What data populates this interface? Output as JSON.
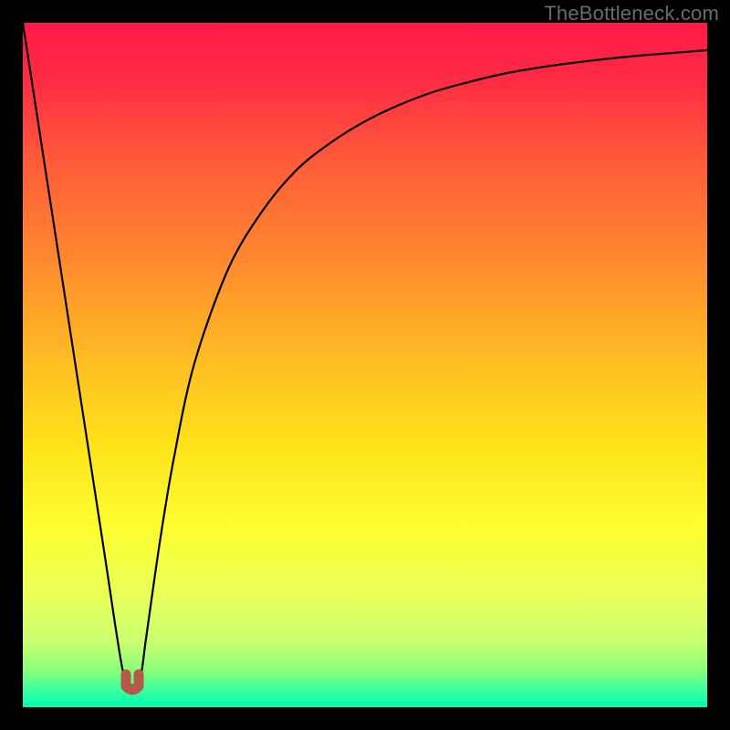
{
  "credit": "TheBottleneck.com",
  "chart_data": {
    "type": "line",
    "title": "",
    "xlabel": "",
    "ylabel": "",
    "xlim": [
      0,
      100
    ],
    "ylim": [
      0,
      100
    ],
    "series": [
      {
        "name": "bottleneck-curve",
        "x": [
          0,
          2,
          4,
          6,
          8,
          10,
          12,
          13.5,
          14.8,
          16,
          17.2,
          18,
          20,
          22,
          25,
          30,
          35,
          40,
          45,
          50,
          55,
          60,
          65,
          70,
          75,
          80,
          85,
          90,
          95,
          100
        ],
        "y": [
          100,
          87,
          74,
          61,
          48,
          35,
          22,
          12,
          4.5,
          3.2,
          4.5,
          10,
          24,
          36,
          50,
          64,
          72.5,
          78.5,
          82.5,
          85.6,
          88,
          89.9,
          91.3,
          92.5,
          93.4,
          94.1,
          94.7,
          95.2,
          95.6,
          96
        ]
      }
    ],
    "annotations": [
      {
        "name": "min-marker",
        "x": 16,
        "y": 3.2
      }
    ],
    "background_gradient": {
      "stops": [
        {
          "offset": 0.0,
          "color": "#ff1a47"
        },
        {
          "offset": 0.08,
          "color": "#ff2a44"
        },
        {
          "offset": 0.2,
          "color": "#ff5a3a"
        },
        {
          "offset": 0.35,
          "color": "#ff8a2e"
        },
        {
          "offset": 0.5,
          "color": "#ffbf22"
        },
        {
          "offset": 0.62,
          "color": "#ffe31a"
        },
        {
          "offset": 0.74,
          "color": "#fcff30"
        },
        {
          "offset": 0.84,
          "color": "#e8ff5a"
        },
        {
          "offset": 0.905,
          "color": "#c8ff70"
        },
        {
          "offset": 0.945,
          "color": "#8aff7a"
        },
        {
          "offset": 0.975,
          "color": "#3affa0"
        },
        {
          "offset": 1.0,
          "color": "#00ffb0"
        }
      ]
    },
    "marker_color": "#b55a4a"
  }
}
